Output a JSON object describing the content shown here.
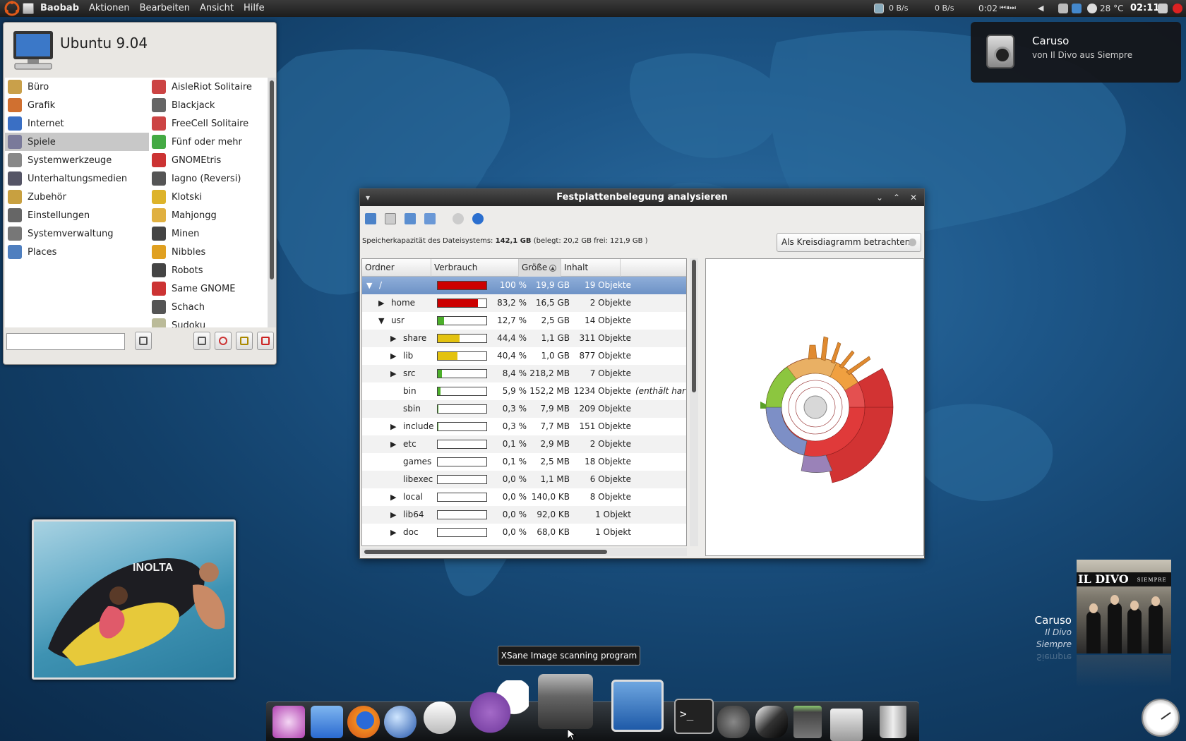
{
  "topbar": {
    "app_name": "Baobab",
    "menus": [
      "Aktionen",
      "Bearbeiten",
      "Ansicht",
      "Hilfe"
    ],
    "net_down": "0 B/s",
    "net_up": "0 B/s",
    "media_time": "0:02",
    "temperature": "28 °C",
    "clock": "02:11"
  },
  "notification": {
    "title": "Caruso",
    "subtitle": "von Il Divo aus Siempre",
    "icon": "speaker-icon"
  },
  "main_menu": {
    "title": "Ubuntu 9.04",
    "categories": [
      {
        "label": "Büro",
        "color": "#c9a04a"
      },
      {
        "label": "Grafik",
        "color": "#d07030"
      },
      {
        "label": "Internet",
        "color": "#3a6fc4"
      },
      {
        "label": "Spiele",
        "color": "#7a7a9a",
        "selected": true
      },
      {
        "label": "Systemwerkzeuge",
        "color": "#888888"
      },
      {
        "label": "Unterhaltungsmedien",
        "color": "#556"
      },
      {
        "label": "Zubehör",
        "color": "#c8a040"
      },
      {
        "label": "Einstellungen",
        "color": "#666666"
      },
      {
        "label": "Systemverwaltung",
        "color": "#777777"
      },
      {
        "label": "Places",
        "color": "#4f7fbf"
      }
    ],
    "apps": [
      {
        "label": "AisleRiot Solitaire",
        "color": "#c44"
      },
      {
        "label": "Blackjack",
        "color": "#666"
      },
      {
        "label": "FreeCell Solitaire",
        "color": "#c44"
      },
      {
        "label": "Fünf oder mehr",
        "color": "#4a4"
      },
      {
        "label": "GNOMEtris",
        "color": "#c33"
      },
      {
        "label": "Iagno (Reversi)",
        "color": "#555"
      },
      {
        "label": "Klotski",
        "color": "#ddb32a"
      },
      {
        "label": "Mahjongg",
        "color": "#e0b040"
      },
      {
        "label": "Minen",
        "color": "#444"
      },
      {
        "label": "Nibbles",
        "color": "#e0a020"
      },
      {
        "label": "Robots",
        "color": "#444"
      },
      {
        "label": "Same GNOME",
        "color": "#c33"
      },
      {
        "label": "Schach",
        "color": "#555"
      },
      {
        "label": "Sudoku",
        "color": "#bb9"
      }
    ]
  },
  "baobab": {
    "title": "Festplattenbelegung analysieren",
    "capacity_label": "Speicherkapazität des Dateisystems:",
    "capacity_value": "142,1 GB",
    "capacity_detail": "(belegt: 20,2 GB frei: 121,9 GB )",
    "view_select": "Als Kreisdiagramm betrachten",
    "columns": [
      "Ordner",
      "Verbrauch",
      "Größe",
      "Inhalt"
    ],
    "rows": [
      {
        "name": "/",
        "expander": "▼",
        "depth": 0,
        "usage": 1.0,
        "bar_color": "#cc0000",
        "percent": "100 %",
        "size": "19,9 GB",
        "contents": "19 Objekte",
        "extra": ""
      },
      {
        "name": "home",
        "expander": "▶",
        "depth": 1,
        "usage": 0.832,
        "bar_color": "#cc0000",
        "percent": "83,2 %",
        "size": "16,5 GB",
        "contents": "2 Objekte",
        "extra": ""
      },
      {
        "name": "usr",
        "expander": "▼",
        "depth": 1,
        "usage": 0.127,
        "bar_color": "#4caf2a",
        "percent": "12,7 %",
        "size": "2,5 GB",
        "contents": "14 Objekte",
        "extra": ""
      },
      {
        "name": "share",
        "expander": "▶",
        "depth": 2,
        "usage": 0.444,
        "bar_color": "#e3c20f",
        "percent": "44,4 %",
        "size": "1,1 GB",
        "contents": "311 Objekte",
        "extra": ""
      },
      {
        "name": "lib",
        "expander": "▶",
        "depth": 2,
        "usage": 0.404,
        "bar_color": "#e3c20f",
        "percent": "40,4 %",
        "size": "1,0 GB",
        "contents": "877 Objekte",
        "extra": ""
      },
      {
        "name": "src",
        "expander": "▶",
        "depth": 2,
        "usage": 0.084,
        "bar_color": "#4caf2a",
        "percent": "8,4 %",
        "size": "218,2 MB",
        "contents": "7 Objekte",
        "extra": ""
      },
      {
        "name": "bin",
        "expander": "",
        "depth": 2,
        "usage": 0.059,
        "bar_color": "#4caf2a",
        "percent": "5,9 %",
        "size": "152,2 MB",
        "contents": "1234 Objekte",
        "extra": "(enthält harte V"
      },
      {
        "name": "sbin",
        "expander": "",
        "depth": 2,
        "usage": 0.003,
        "bar_color": "#4caf2a",
        "percent": "0,3 %",
        "size": "7,9 MB",
        "contents": "209 Objekte",
        "extra": ""
      },
      {
        "name": "include",
        "expander": "▶",
        "depth": 2,
        "usage": 0.003,
        "bar_color": "#4caf2a",
        "percent": "0,3 %",
        "size": "7,7 MB",
        "contents": "151 Objekte",
        "extra": ""
      },
      {
        "name": "etc",
        "expander": "▶",
        "depth": 2,
        "usage": 0.001,
        "bar_color": "#4caf2a",
        "percent": "0,1 %",
        "size": "2,9 MB",
        "contents": "2 Objekte",
        "extra": ""
      },
      {
        "name": "games",
        "expander": "",
        "depth": 2,
        "usage": 0.001,
        "bar_color": "#4caf2a",
        "percent": "0,1 %",
        "size": "2,5 MB",
        "contents": "18 Objekte",
        "extra": ""
      },
      {
        "name": "libexec",
        "expander": "",
        "depth": 2,
        "usage": 0.0,
        "bar_color": "#4caf2a",
        "percent": "0,0 %",
        "size": "1,1 MB",
        "contents": "6 Objekte",
        "extra": ""
      },
      {
        "name": "local",
        "expander": "▶",
        "depth": 2,
        "usage": 0.0,
        "bar_color": "#4caf2a",
        "percent": "0,0 %",
        "size": "140,0 KB",
        "contents": "8 Objekte",
        "extra": ""
      },
      {
        "name": "lib64",
        "expander": "▶",
        "depth": 2,
        "usage": 0.0,
        "bar_color": "#4caf2a",
        "percent": "0,0 %",
        "size": "92,0 KB",
        "contents": "1 Objekt",
        "extra": ""
      },
      {
        "name": "doc",
        "expander": "▶",
        "depth": 2,
        "usage": 0.0,
        "bar_color": "#4caf2a",
        "percent": "0,0 %",
        "size": "68,0 KB",
        "contents": "1 Objekt",
        "extra": ""
      }
    ]
  },
  "dock": {
    "tooltip": "XSane Image scanning program",
    "items": [
      "system-settings-icon",
      "file-manager-icon",
      "firefox-icon",
      "google-earth-icon",
      "mail-clock-icon",
      "pidgin-icon",
      "scanner-icon",
      "system-monitor-icon",
      "terminal-icon",
      "gimp-icon",
      "inkscape-icon",
      "calculator-icon",
      "disk-usage-icon",
      "trash-icon"
    ]
  },
  "now_playing": {
    "title": "Caruso",
    "artist": "Il Divo",
    "album": "Siempre",
    "cover_band": "IL DIVO",
    "cover_sub": "SIEMPRE"
  }
}
